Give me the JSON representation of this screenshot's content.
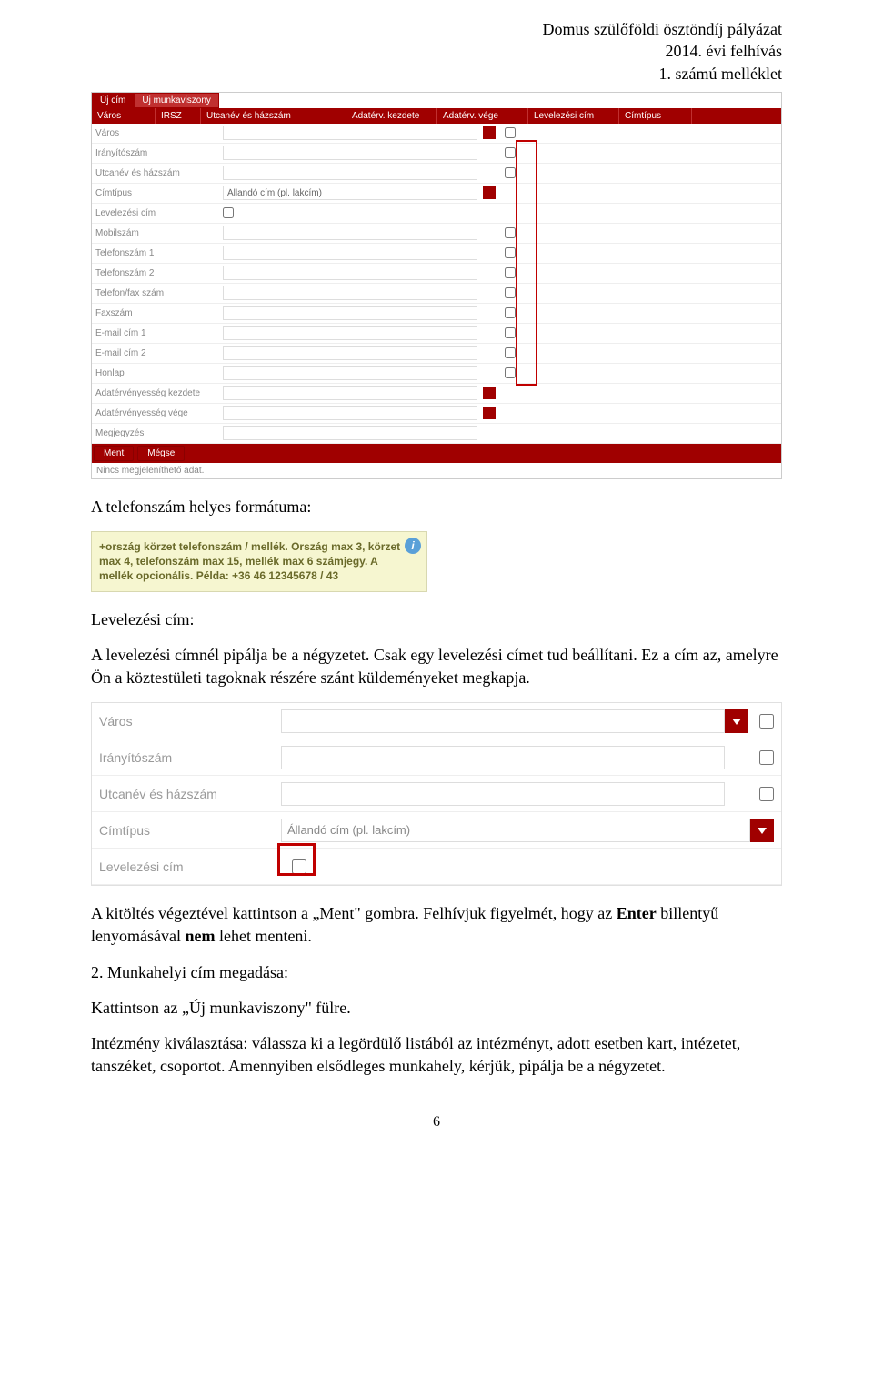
{
  "header": {
    "line1": "Domus szülőföldi ösztöndíj pályázat",
    "line2": "2014. évi felhívás",
    "line3": "1. számú melléklet"
  },
  "screenshot1": {
    "tabs": {
      "t1": "Új cím",
      "t2": "Új munkaviszony"
    },
    "cols": {
      "c1": "Város",
      "c2": "IRSZ",
      "c3": "Utcanév és házszám",
      "c4": "Adatérv. kezdete",
      "c5": "Adatérv. vége",
      "c6": "Levelezési cím",
      "c7": "Címtípus"
    },
    "rows": {
      "varos": "Város",
      "iranyitoszam": "Irányítószám",
      "utcanev": "Utcanév és házszám",
      "cimtipus": "Címtípus",
      "cimtipus_val": "Állandó cím (pl. lakcím)",
      "levelezesi": "Levelezési cím",
      "mobil": "Mobilszám",
      "tel1": "Telefonszám 1",
      "tel2": "Telefonszám 2",
      "telfax": "Telefon/fax szám",
      "fax": "Faxszám",
      "email1": "E-mail cím 1",
      "email2": "E-mail cím 2",
      "honlap": "Honlap",
      "adatkezdet": "Adatérvényesség kezdete",
      "adatvege": "Adatérvényesség vége",
      "megjegyzes": "Megjegyzés"
    },
    "btn_ment": "Ment",
    "btn_megse": "Mégse",
    "nodata": "Nincs megjeleníthető adat."
  },
  "txt_phone_header": "A telefonszám helyes formátuma:",
  "tooltip": {
    "text": "+ország körzet telefonszám / mellék. Ország max 3, körzet max 4, telefonszám max 15, mellék max 6 számjegy. A mellék opcionális. Példa: +36 46 12345678 / 43"
  },
  "txt_levcim_header": "Levelezési cím:",
  "txt_levcim_body": "A levelezési címnél pipálja be a négyzetet. Csak egy levelezési címet tud beállítani. Ez a cím az, amelyre Ön a köztestületi tagoknak részére szánt küldeményeket megkapja.",
  "screenshot2": {
    "varos": "Város",
    "iranyitoszam": "Irányítószám",
    "utcanev": "Utcanév és házszám",
    "cimtipus": "Címtípus",
    "cimtipus_val": "Állandó cím (pl. lakcím)",
    "levelezesi": "Levelezési cím"
  },
  "txt_ment_para": "A kitöltés végeztével kattintson a „Ment\" gombra. Felhívjuk figyelmét, hogy az ",
  "txt_ment_bold1": "Enter",
  "txt_ment_mid": " billentyű lenyomásával ",
  "txt_ment_bold2": "nem",
  "txt_ment_end": " lehet menteni.",
  "txt_munka_header": "2. Munkahelyi cím megadása:",
  "txt_munka_l1": "Kattintson az „Új munkaviszony\" fülre.",
  "txt_munka_l2": "Intézmény kiválasztása: válassza ki a legördülő listából az intézményt, adott esetben kart, intézetet, tanszéket, csoportot. Amennyiben elsődleges munkahely, kérjük, pipálja be a négyzetet.",
  "pagenum": "6"
}
